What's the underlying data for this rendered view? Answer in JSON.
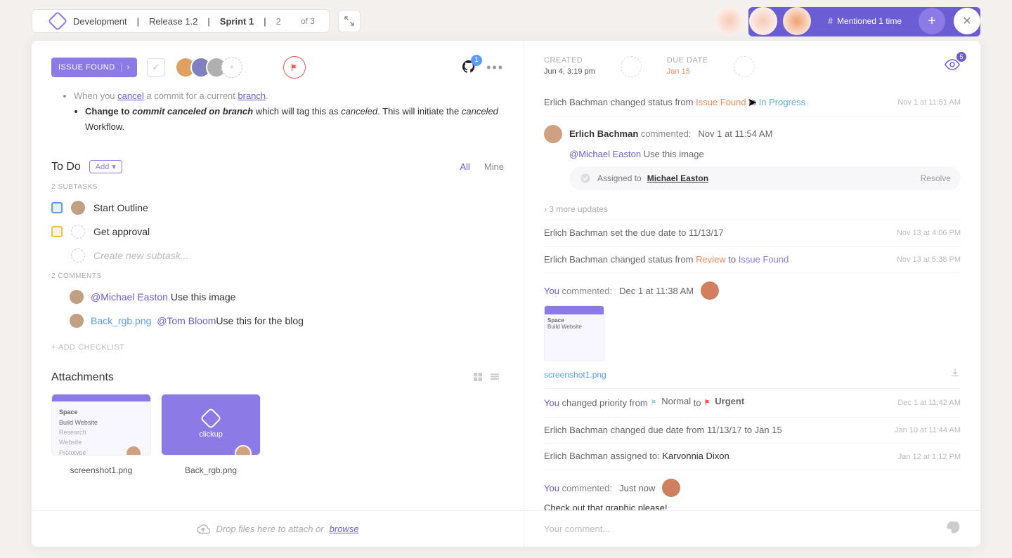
{
  "breadcrumbs": {
    "project": "Development",
    "release": "Release 1.2",
    "sprint": "Sprint 1",
    "index": "2",
    "of": "of 3"
  },
  "topbar": {
    "mentioned": "Mentioned 1 time"
  },
  "header": {
    "status_label": "ISSUE FOUND",
    "github_badge": "1",
    "created_lbl": "CREATED",
    "created_val": "Jun 4, 3:19 pm",
    "due_lbl": "DUE DATE",
    "due_val": "Jan 15",
    "watch_count": "5"
  },
  "description": {
    "line1a": "When you ",
    "cancel": "cancel",
    "line1b": " a commit for a current ",
    "branch": "branch",
    "line1c": ".",
    "line2a": "Change to ",
    "ital": "commit canceled on branch",
    "line2b": " which will tag this as ",
    "canceled": "canceled",
    "line2c": ". This will initiate the ",
    "canceled2": "canceled",
    "line2d": " Workflow."
  },
  "todo": {
    "title": "To Do",
    "add": "Add",
    "tab_all": "All",
    "tab_mine": "Mine",
    "subtasks_lbl": "2 SUBTASKS",
    "tasks": [
      {
        "name": "Start Outline"
      },
      {
        "name": "Get approval"
      }
    ],
    "new_placeholder": "Create new subtask...",
    "comments_lbl": "2 COMMENTS",
    "comments": [
      {
        "mention": "@Michael Easton",
        "text": " Use this image"
      },
      {
        "file": "Back_rgb.png",
        "mention": "@Tom Bloom",
        "text": "Use this for the blog"
      }
    ],
    "add_checklist": "+ ADD CHECKLIST"
  },
  "attachments": {
    "title": "Attachments",
    "files": [
      "screenshot1.png",
      "Back_rgb.png"
    ],
    "drop": "Drop files here to attach or ",
    "browse": "browse",
    "thumb_title": "Space",
    "thumb_sub": "Build Website",
    "thumb_brand": "clickup"
  },
  "activity": {
    "row1": {
      "who": "Erlich Bachman",
      "verb": " changed status from ",
      "from": "Issue Found",
      "to_lbl": " to ",
      "to": "In Progress",
      "time": "Nov 1 at 11:51 AM"
    },
    "comment1": {
      "name": "Erlich Bachman",
      "verb": " commented:",
      "time": "Nov 1 at 11:54 AM",
      "mention": "@Michael Easton",
      "text": " Use this image",
      "assigned_lbl": "Assigned to ",
      "assigned": "Michael Easton",
      "resolve": "Resolve"
    },
    "more": "› 3 more updates",
    "row2": {
      "txt": "Erlich Bachman set the due date to 11/13/17",
      "time": "Nov 13 at 4:06 PM"
    },
    "row3": {
      "who": "Erlich Bachman",
      "verb": " changed status from ",
      "from": "Review",
      "to_lbl": " to ",
      "to": "Issue Found",
      "time": "Nov 13 at 5:38 PM"
    },
    "comment2": {
      "who": "You",
      "verb": " commented:",
      "time": "Dec 1 at 11:38 AM",
      "file": "screenshot1.png"
    },
    "row4": {
      "who": "You",
      "verb": " changed priority from ",
      "from": "Normal",
      "to_lbl": " to ",
      "to": "Urgent",
      "time": "Dec 1 at 11:42 AM"
    },
    "row5": {
      "txt": "Erlich Bachman changed due date from 11/13/17 to Jan 15",
      "time": "Jan 10 at 11:44 AM"
    },
    "row6": {
      "who": "Erlich Bachman assigned to: ",
      "name": "Karvonnia Dixon",
      "time": "Jan 12 at 1:12 PM"
    },
    "comment3": {
      "who": "You",
      "verb": " commented:",
      "time": "Just now",
      "text": "Check out that graphic please!"
    },
    "input_placeholder": "Your comment..."
  }
}
